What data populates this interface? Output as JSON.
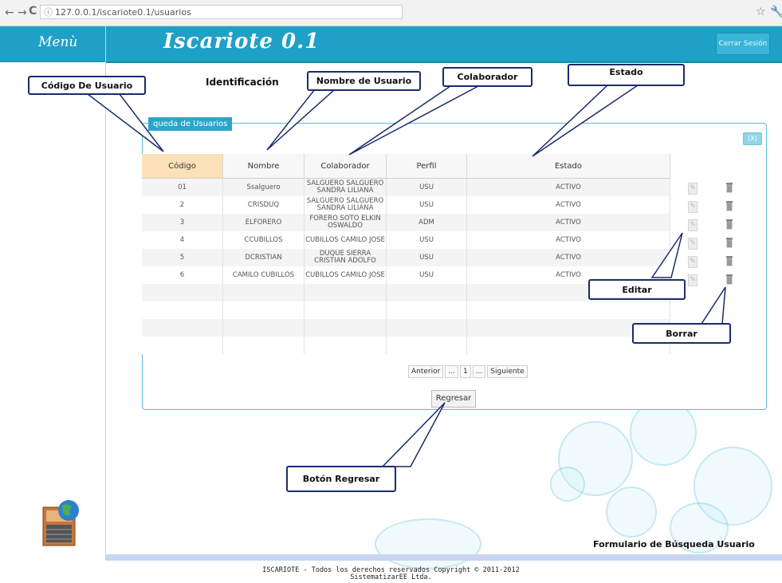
{
  "browser": {
    "url": "127.0.0.1/iscariote0.1/usuarios"
  },
  "header": {
    "menu_label": "Menù",
    "app_title": "Iscariote 0.1",
    "logout_label": "Cerrar Sesión"
  },
  "main": {
    "heading": "Identificación",
    "panel_title": "queda de Usuarios",
    "close_label": "(X)",
    "columns": [
      "Código",
      "Nombre",
      "Colaborador",
      "Perfil",
      "Estado"
    ],
    "rows": [
      {
        "codigo": "01",
        "nombre": "Ssalguero",
        "colaborador": "SALGUERO SALGUERO SANDRA LILIANA",
        "perfil": "USU",
        "estado": "ACTIVO"
      },
      {
        "codigo": "2",
        "nombre": "CRISDUQ",
        "colaborador": "SALGUERO SALGUERO SANDRA LILIANA",
        "perfil": "USU",
        "estado": "ACTIVO"
      },
      {
        "codigo": "3",
        "nombre": "ELFORERO",
        "colaborador": "FORERO SOTO ELKIN OSWALDO",
        "perfil": "ADM",
        "estado": "ACTIVO"
      },
      {
        "codigo": "4",
        "nombre": "CCUBILLOS",
        "colaborador": "CUBILLOS CAMILO JOSE",
        "perfil": "USU",
        "estado": "ACTIVO"
      },
      {
        "codigo": "5",
        "nombre": "DCRISTIAN",
        "colaborador": "DUQUE SIERRA CRISTIAN ADOLFO",
        "perfil": "USU",
        "estado": "ACTIVO"
      },
      {
        "codigo": "6",
        "nombre": "CAMILO CUBILLOS",
        "colaborador": "CUBILLOS CAMILO JOSE",
        "perfil": "USU",
        "estado": "ACTIVO"
      }
    ],
    "pager": {
      "prev": "Anterior",
      "ellipsis": "...",
      "page": "1",
      "next": "Siguiente"
    },
    "back_button": "Regresar"
  },
  "annotations": {
    "codigo": "Código De Usuario",
    "nombre": "Nombre de Usuario",
    "colaborador": "Colaborador",
    "estado": "Estado",
    "editar": "Editar",
    "borrar": "Borrar",
    "regresar": "Botón Regresar",
    "form_caption": "Formulario de Búsqueda Usuario"
  },
  "footer": {
    "line1": "ISCARIOTE - Todos los derechos reservados Copyright © 2011-2012",
    "line2": "SistematizarEE Ltda."
  }
}
